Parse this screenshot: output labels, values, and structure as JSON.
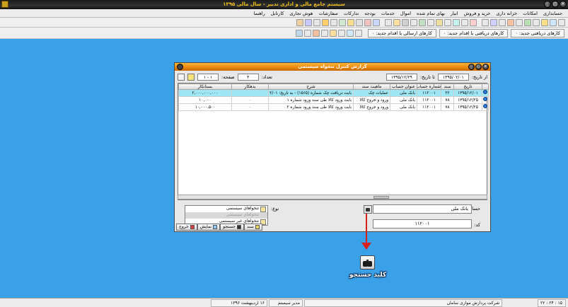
{
  "window": {
    "title": "سیستم جامع مالی و اداری تدبیر - سال مالی ۱۳۹۵"
  },
  "menu": [
    "حسابداری",
    "امکانات",
    "خزانه داری",
    "خرید و فروش",
    "انبار",
    "بهای تمام شده",
    "اموال",
    "خدمات",
    "بودجه",
    "تدارکات",
    "سفارشات",
    "هوش تجاری",
    "کارتابل",
    "راهنما"
  ],
  "toolbar2": {
    "tabs": [
      "کارهای دریافتی جدید: ۰",
      "کارهای دریافتی با اقدام جدید: ۰",
      "کارهای ارسالی با اقدام جدید: ۰"
    ]
  },
  "dialog": {
    "title": "گزارش کنترل تنخواه سیستمی",
    "from_date_label": "از تاریخ:",
    "from_date": "۱۳۹۵/۰۲/۰۱",
    "to_date_label": "تا تاریخ:",
    "to_date": "۱۳۹۵/۱۲/۲۹",
    "count_label": "تعداد:",
    "count": "۳",
    "page_label": "صفحه:",
    "page": "۱ - ۱",
    "columns": [
      "تاریخ",
      "سند",
      "شماره حساب",
      "عنوان حساب",
      "ماهیت سند",
      "شرح",
      "بدهکار",
      "بستانکار"
    ],
    "rows": [
      [
        "۱۳۹۵/۱۲/۰۱",
        "۲۲",
        "۱۱۲۰۰۱",
        "بانک ملی",
        "عملیات چک",
        "بابت دریافت چک شماره (۱۵۶۵) - به تاریخ: ۱۳۹۵/۱۲/۰۱ - ملی",
        "",
        "۲,۰۰۰,۰۰۰,۰۰۰"
      ],
      [
        "۱۳۹۵/۱۲/۲۵",
        "۷۸",
        "۱۱۲۰۰۱",
        "بانک ملی",
        "ورود و خروج کالا",
        "بابت ورود کالا طی سند ورود شماره ۱",
        "۰",
        "۱۰,۰۰۰"
      ],
      [
        "۱۳۹۵/۱۲/۲۵",
        "۷۸",
        "۱۱۲۰۰۱",
        "بانک ملی",
        "ورود و خروج کالا",
        "بابت ورود کالا طی سند ورود شماره ۲",
        "۰",
        "۱۰,۰۰۰,۵۰۰"
      ]
    ],
    "account_label": "حساب:",
    "account_value": "بانک ملی",
    "code_label": "کد:",
    "code_value": "۱۱۲۰۰۱",
    "type_label": "نوع:",
    "type_options": [
      "تنخواهای سیستمی",
      "تنخواهای سیستمی",
      "تنخواهای غیر سیستمی"
    ],
    "buttons": [
      "سند",
      "جستجو",
      "نمایش",
      "خروج"
    ]
  },
  "annotation": {
    "label": "کلید جستجو"
  },
  "status": {
    "company": "شرکت پردازش موازی سامان",
    "user": "مدیر سیستم",
    "date": "۱۶ اردیبهشت ۱۳۹۶",
    "time": "۲۲ : ۲۴ : ۱۵"
  },
  "colors": {
    "desktop": "#3aa0e8",
    "dialog_title": "#e8860c",
    "selected_row": "#9fe7f5",
    "arrow": "#d8201a"
  }
}
